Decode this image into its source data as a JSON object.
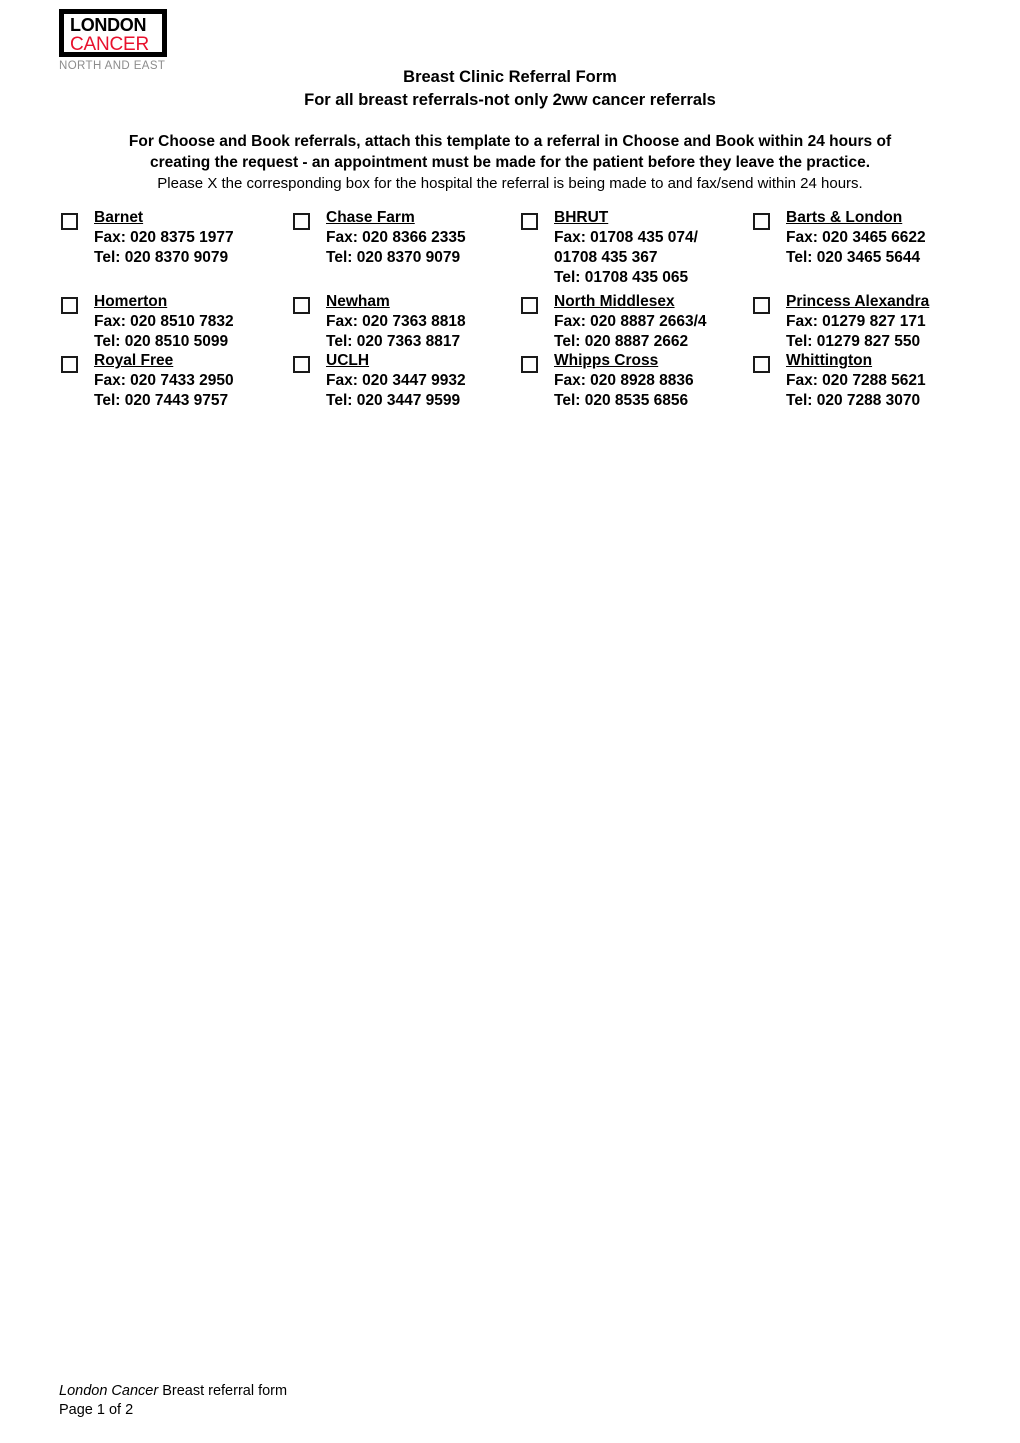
{
  "logo": {
    "line1": "LONDON",
    "line2": "CANCER",
    "subtitle": "NORTH AND EAST",
    "colors": {
      "london": "#000000",
      "cancer": "#e8112d",
      "subtitle": "#8c8c8c"
    }
  },
  "title": {
    "line1": "Breast Clinic Referral Form",
    "line2": "For all breast referrals-not only 2ww cancer referrals"
  },
  "instructions": {
    "bold_line1": "For Choose and Book referrals, attach this template to a referral in Choose and Book within 24 hours of",
    "bold_line2": "creating the request - an appointment must be made for the patient before they leave the practice.",
    "plain_line": "Please X the corresponding box for the hospital the referral is being made to and fax/send within 24 hours."
  },
  "hospitals": [
    [
      {
        "name": "Barnet",
        "lines": [
          "Fax: 020 8375 1977",
          "Tel:  020 8370 9079"
        ]
      },
      {
        "name": "Chase Farm",
        "lines": [
          "Fax: 020 8366 2335",
          "Tel:  020 8370 9079"
        ]
      },
      {
        "name": "BHRUT",
        "lines": [
          "Fax: 01708 435 074/",
          "01708 435 367",
          "Tel:  01708 435 065"
        ]
      },
      {
        "name": "Barts & London",
        "lines": [
          "Fax: 020 3465 6622",
          "Tel:  020 3465 5644"
        ]
      }
    ],
    [
      {
        "name": "Homerton",
        "lines": [
          "Fax: 020 8510 7832",
          "Tel:  020 8510 5099"
        ]
      },
      {
        "name": "Newham",
        "lines": [
          "Fax: 020 7363 8818",
          "Tel:  020 7363 8817"
        ]
      },
      {
        "name": "North Middlesex",
        "lines": [
          "Fax: 020 8887 2663/4",
          "Tel:  020 8887 2662"
        ]
      },
      {
        "name": "Princess Alexandra",
        "lines": [
          "Fax: 01279 827 171",
          "Tel:  01279 827 550"
        ]
      }
    ],
    [
      {
        "name": "Royal Free",
        "lines": [
          "Fax: 020 7433 2950",
          "Tel:  020 7443 9757"
        ]
      },
      {
        "name": "UCLH",
        "lines": [
          "Fax: 020 3447 9932",
          "Tel:  020 3447 9599"
        ]
      },
      {
        "name": "Whipps Cross",
        "lines": [
          "Fax: 020 8928 8836",
          "Tel:  020 8535 6856"
        ]
      },
      {
        "name": "Whittington",
        "lines": [
          "Fax: 020 7288 5621",
          "Tel:  020 7288 3070"
        ]
      }
    ]
  ],
  "footer": {
    "italic_part": "London Cancer",
    "regular_part": " Breast referral form",
    "page_label": "Page 1 of 2"
  }
}
